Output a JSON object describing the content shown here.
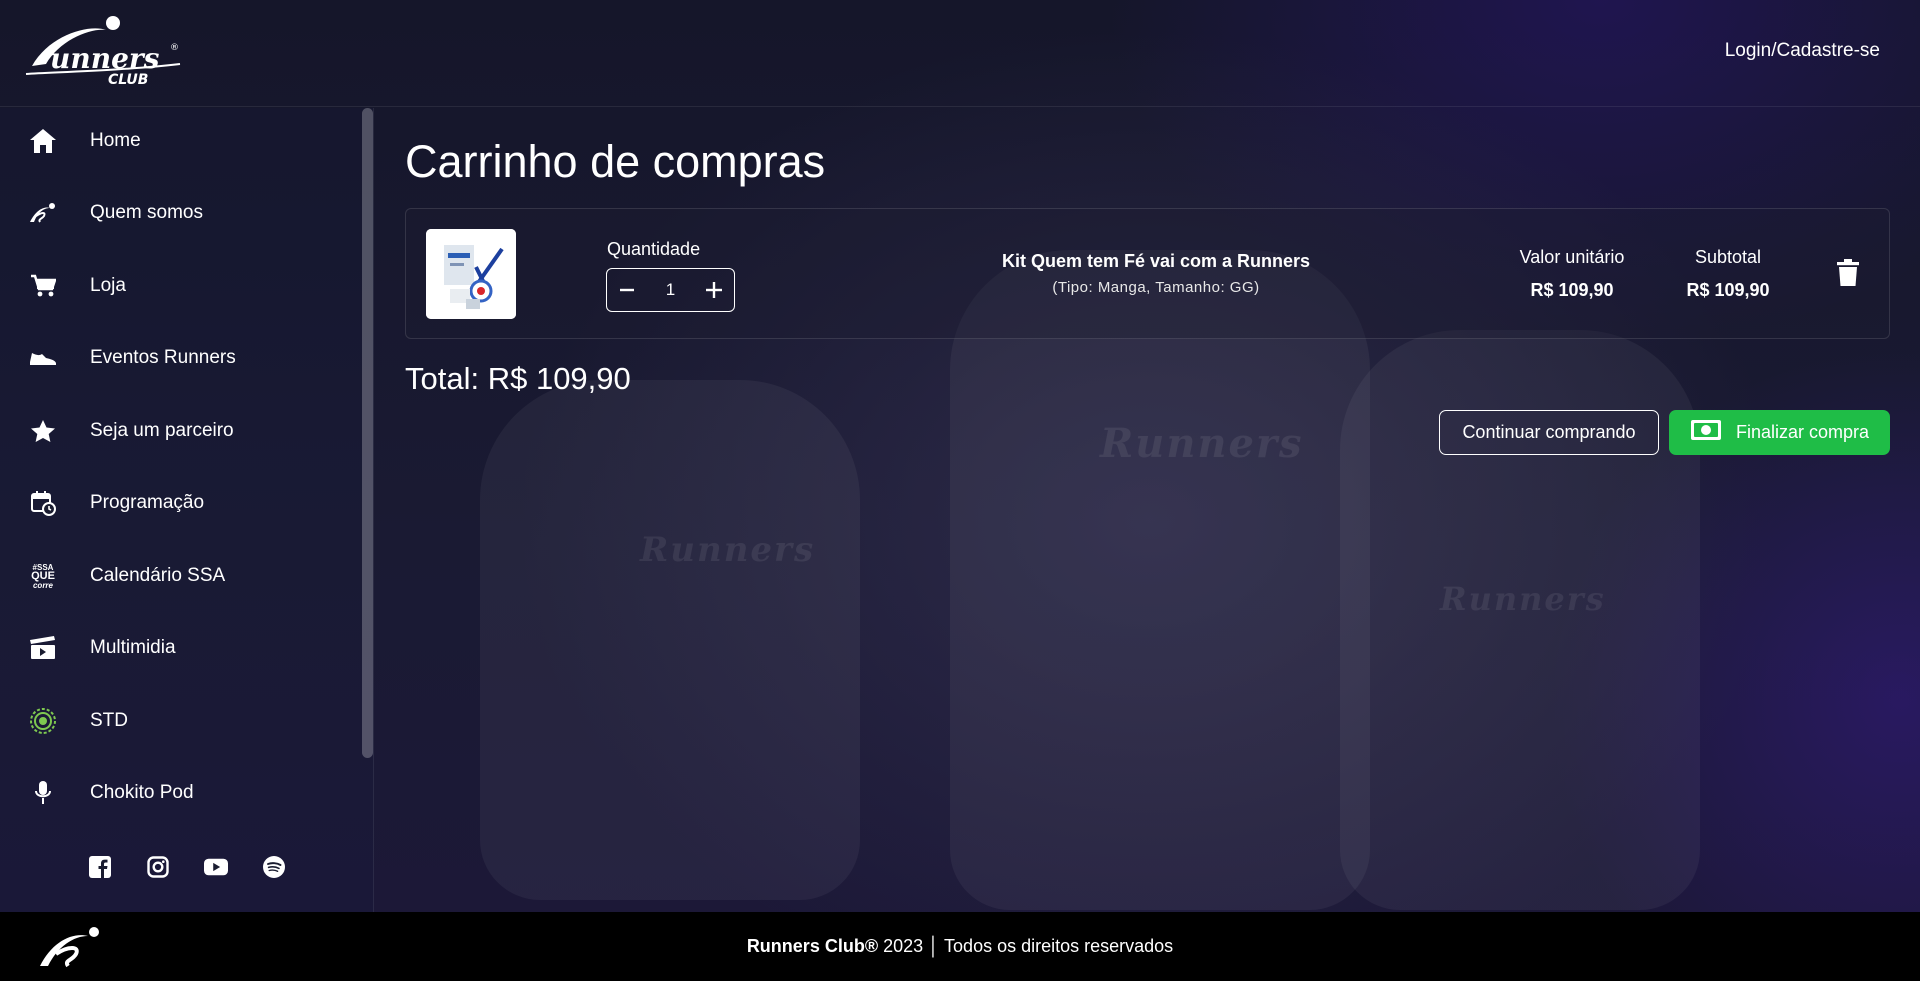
{
  "brand": {
    "logo_main": "Runners",
    "logo_sub": "CLUB",
    "registered_mark": "®"
  },
  "header": {
    "login_label": "Login/Cadastre-se"
  },
  "sidebar": {
    "items": [
      {
        "label": "Home",
        "icon": "home-icon"
      },
      {
        "label": "Quem somos",
        "icon": "runners-logo-icon"
      },
      {
        "label": "Loja",
        "icon": "cart-icon"
      },
      {
        "label": "Eventos Runners",
        "icon": "shoe-icon"
      },
      {
        "label": "Seja um parceiro",
        "icon": "star-icon"
      },
      {
        "label": "Programação",
        "icon": "calendar-clock-icon"
      },
      {
        "label": "Calendário SSA",
        "icon": "ssa-que-corre-icon"
      },
      {
        "label": "Multimidia",
        "icon": "clapperboard-icon"
      },
      {
        "label": "STD",
        "icon": "std-icon"
      },
      {
        "label": "Chokito Pod",
        "icon": "microphone-icon"
      }
    ],
    "ssa_icon_text": [
      "#SSA",
      "QUE",
      "corre"
    ],
    "socials": [
      "facebook-icon",
      "instagram-icon",
      "youtube-icon",
      "spotify-icon"
    ]
  },
  "main": {
    "title": "Carrinho de compras",
    "cart": {
      "quantity_label": "Quantidade",
      "quantity": "1",
      "product_name": "Kit Quem tem Fé vai com a Runners",
      "product_variant": "(Tipo: Manga, Tamanho: GG)",
      "unit_price_label": "Valor unitário",
      "unit_price": "R$ 109,90",
      "subtotal_label": "Subtotal",
      "subtotal": "R$ 109,90"
    },
    "total": "Total: R$ 109,90",
    "continue_label": "Continuar comprando",
    "finish_label": "Finalizar compra"
  },
  "footer": {
    "brand": "Runners Club®",
    "text": " 2023 │ Todos os direitos reservados"
  },
  "colors": {
    "accent_green": "#1fbd47",
    "footer_bg": "#000000"
  }
}
